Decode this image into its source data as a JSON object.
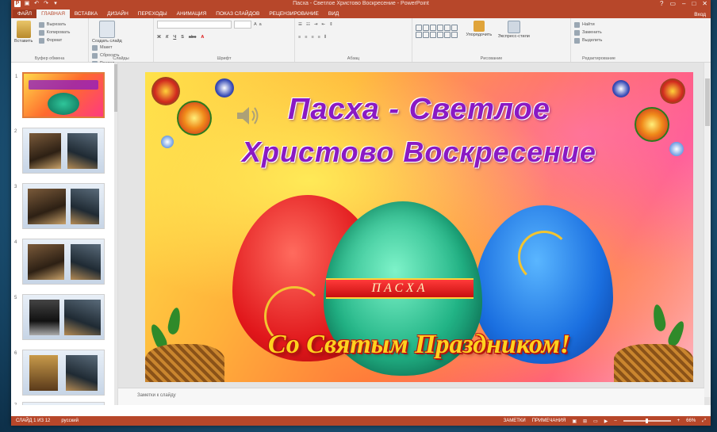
{
  "app": {
    "window_title": "Пасха - Светлое Христово Воскресение - PowerPoint",
    "sign_in": "Вход"
  },
  "ribbon": {
    "tabs": [
      "ФАЙЛ",
      "ГЛАВНАЯ",
      "ВСТАВКА",
      "ДИЗАЙН",
      "ПЕРЕХОДЫ",
      "АНИМАЦИЯ",
      "ПОКАЗ СЛАЙДОВ",
      "РЕЦЕНЗИРОВАНИЕ",
      "ВИД"
    ],
    "groups": [
      "Буфер обмена",
      "Слайды",
      "Шрифт",
      "Абзац",
      "Рисование",
      "Редактирование"
    ],
    "buttons": {
      "paste": "Вставить",
      "new_slide": "Создать слайд",
      "layout": "Макет",
      "reset": "Сбросить",
      "section": "Раздел",
      "arrange": "Упорядочить",
      "quick_styles": "Экспресс-стили",
      "find": "Найти",
      "replace": "Заменить",
      "select": "Выделить"
    }
  },
  "thumbnails": [
    {
      "num": "1",
      "selected": true
    },
    {
      "num": "2",
      "selected": false
    },
    {
      "num": "3",
      "selected": false
    },
    {
      "num": "4",
      "selected": false
    },
    {
      "num": "5",
      "selected": false
    },
    {
      "num": "6",
      "selected": false
    },
    {
      "num": "7",
      "selected": false
    }
  ],
  "slide": {
    "title_line1": "Пасха - Светлое",
    "title_line2": "Христово Воскресение",
    "egg_band": "ПАСХА",
    "greeting": "Со Святым Праздником!"
  },
  "notes": {
    "placeholder": "Заметки к слайду"
  },
  "statusbar": {
    "slide_info": "СЛАЙД 1 ИЗ 12",
    "language": "русский",
    "notes_btn": "ЗАМЕТКИ",
    "comments_btn": "ПРИМЕЧАНИЯ",
    "zoom": "66%"
  }
}
